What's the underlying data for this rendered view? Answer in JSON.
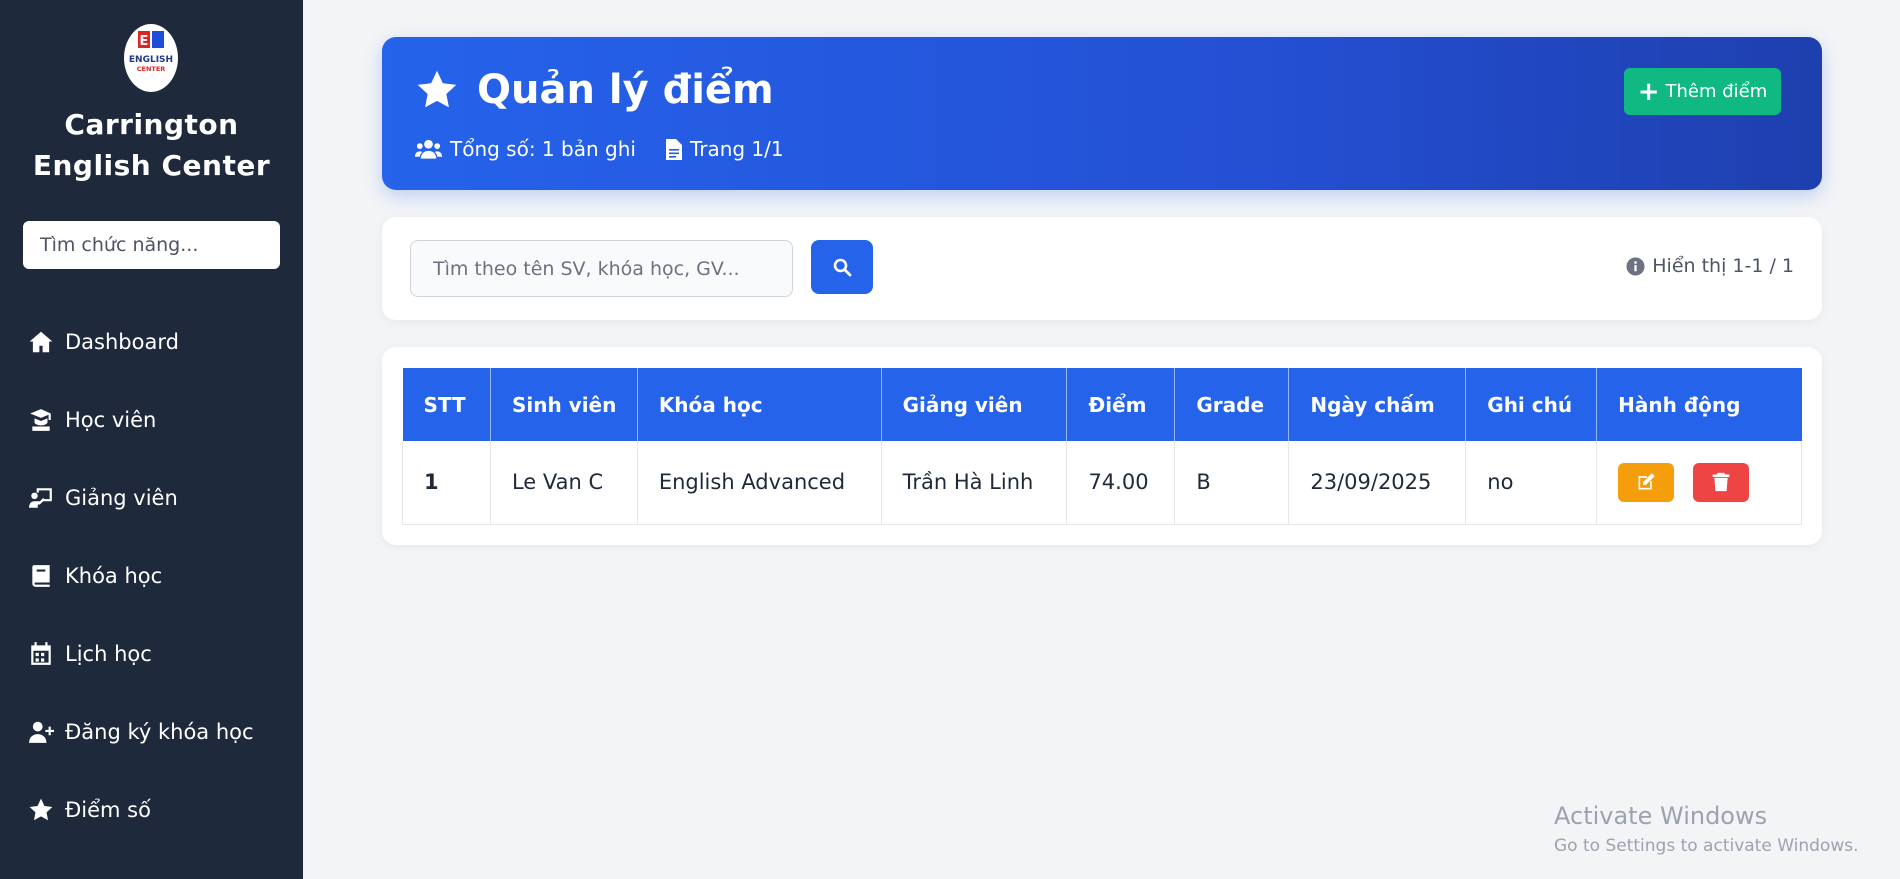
{
  "brand": {
    "logo_text": [
      "E",
      "ENGLISH",
      "CENTER"
    ],
    "name_line1": "Carrington",
    "name_line2": "English Center"
  },
  "sidebar": {
    "search_placeholder": "Tìm chức năng...",
    "items": [
      {
        "label": "Dashboard",
        "icon": "home-icon"
      },
      {
        "label": "Học viên",
        "icon": "graduate-icon"
      },
      {
        "label": "Giảng viên",
        "icon": "teacher-board-icon"
      },
      {
        "label": "Khóa học",
        "icon": "book-icon"
      },
      {
        "label": "Lịch học",
        "icon": "calendar-icon"
      },
      {
        "label": "Đăng ký khóa học",
        "icon": "user-plus-icon"
      },
      {
        "label": "Điểm số",
        "icon": "star-icon"
      }
    ]
  },
  "header": {
    "title": "Quản lý điểm",
    "total": "Tổng số: 1 bản ghi",
    "page": "Trang 1/1",
    "add_label": "Thêm điểm",
    "icon": "star-icon"
  },
  "search": {
    "placeholder": "Tìm theo tên SV, khóa học, GV...",
    "display_info": "Hiển thị 1-1 / 1"
  },
  "table": {
    "headers": [
      "STT",
      "Sinh viên",
      "Khóa học",
      "Giảng viên",
      "Điểm",
      "Grade",
      "Ngày chấm",
      "Ghi chú",
      "Hành động"
    ],
    "rows": [
      [
        "1",
        "Le Van C",
        "English Advanced",
        "Trần Hà Linh",
        "74.00",
        "B",
        "23/09/2025",
        "no"
      ]
    ]
  },
  "watermark": {
    "title": "Activate Windows",
    "subtitle": "Go to Settings to activate Windows."
  },
  "colors": {
    "sidebar_bg": "#1e293b",
    "primary": "#2563eb",
    "success": "#10b981",
    "warning": "#f59e0b",
    "danger": "#ef4444"
  }
}
